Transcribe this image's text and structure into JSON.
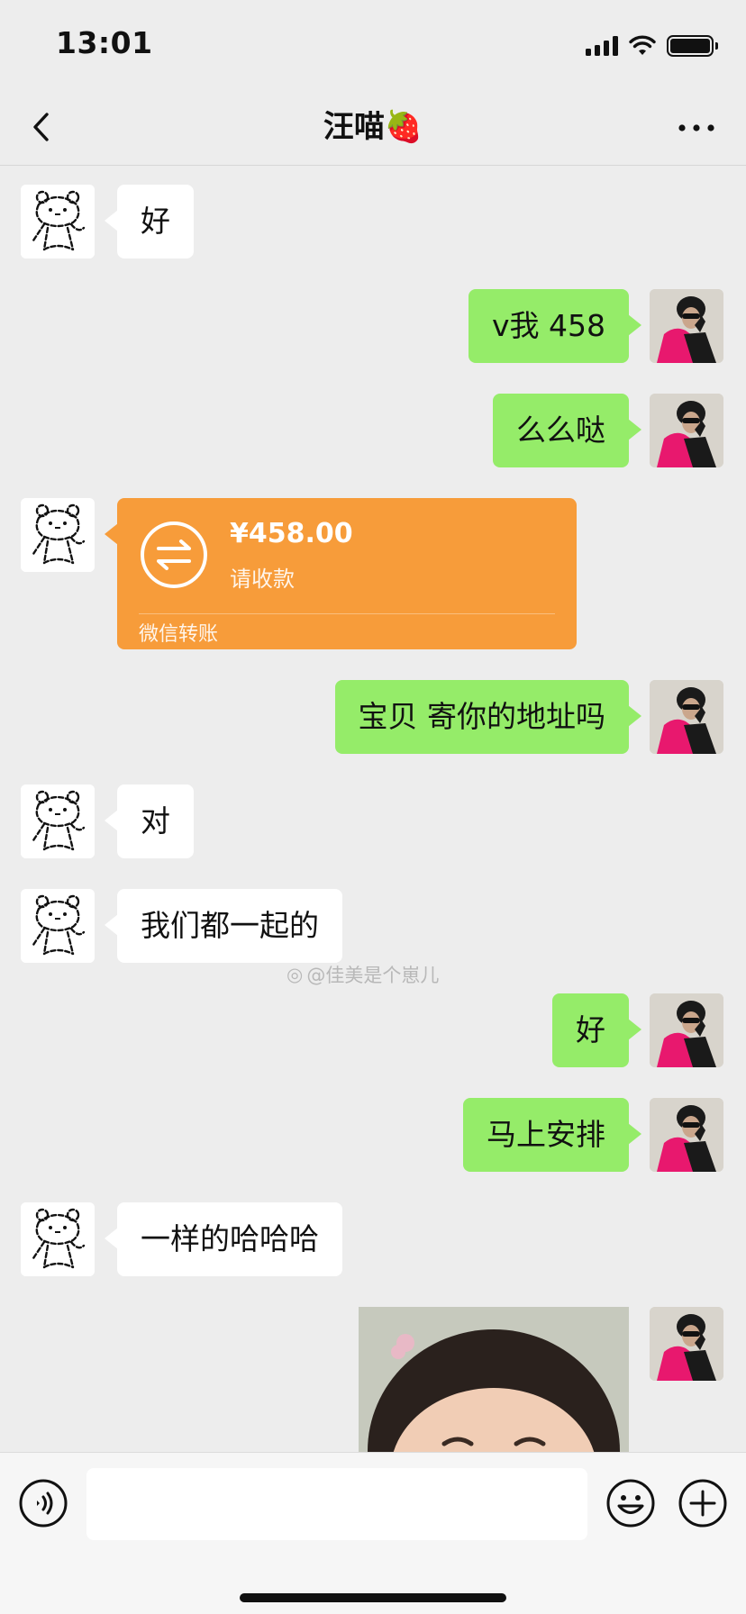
{
  "status_bar": {
    "time": "13:01"
  },
  "header": {
    "title": "汪喵🍓"
  },
  "messages": [
    {
      "side": "in",
      "text": "好"
    },
    {
      "side": "out",
      "text": "v我 458"
    },
    {
      "side": "out",
      "text": "么么哒"
    },
    {
      "side": "in",
      "type": "transfer",
      "amount": "¥458.00",
      "status": "请收款",
      "footer": "微信转账"
    },
    {
      "side": "out",
      "text": "宝贝 寄你的地址吗"
    },
    {
      "side": "in",
      "text": "对"
    },
    {
      "side": "in",
      "text": "我们都一起的"
    },
    {
      "side": "out",
      "text": "好"
    },
    {
      "side": "out",
      "text": "马上安排"
    },
    {
      "side": "in",
      "text": "一样的哈哈哈"
    },
    {
      "side": "out",
      "type": "image"
    }
  ],
  "watermark": "@佳美是个崽儿",
  "input": {
    "value": ""
  },
  "colors": {
    "outgoing_bubble": "#95ec69",
    "incoming_bubble": "#ffffff",
    "transfer_card": "#f79c3a",
    "background": "#ededed"
  }
}
